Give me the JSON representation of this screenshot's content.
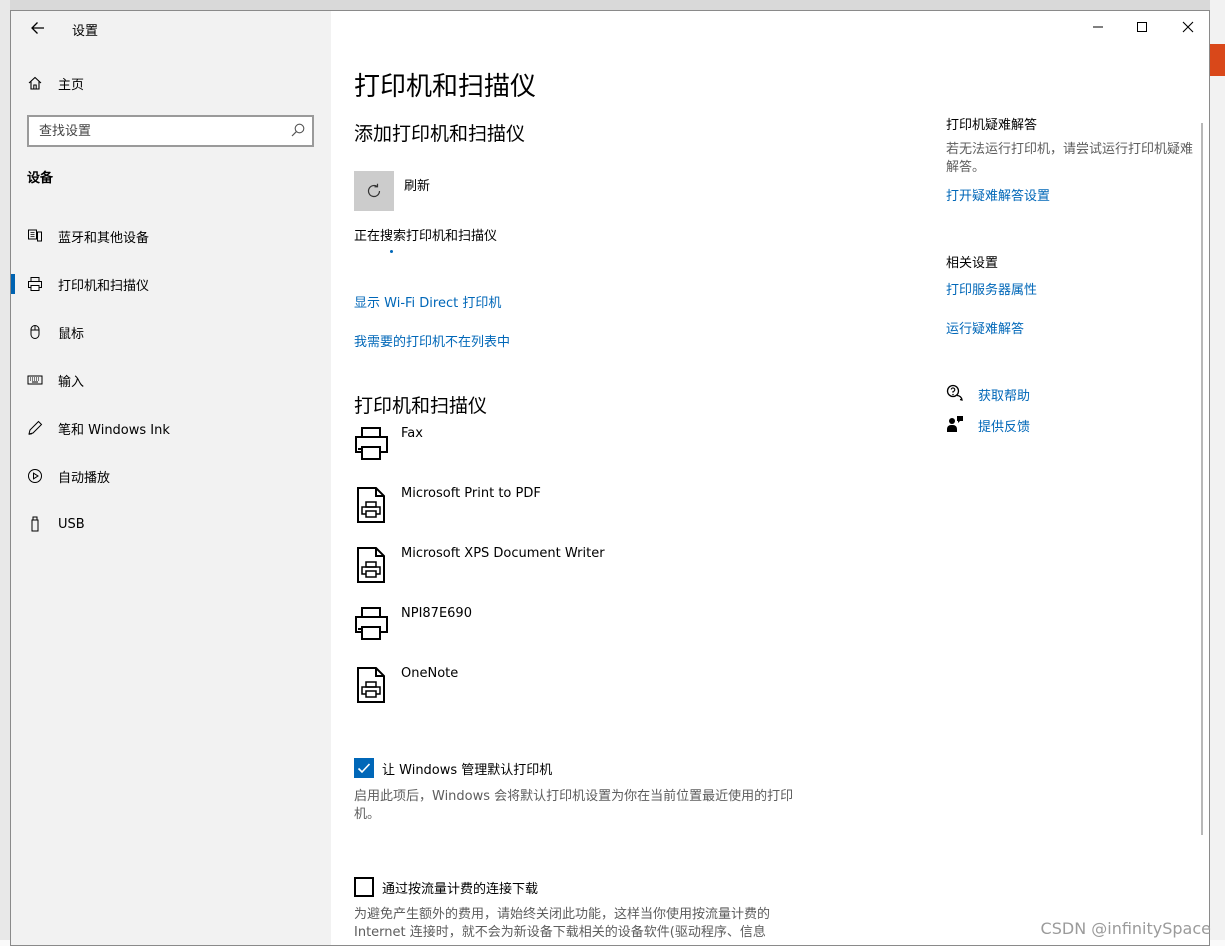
{
  "window": {
    "title": "设置",
    "back_icon": "back-arrow-icon",
    "minimize_icon": "minimize-icon",
    "maximize_icon": "maximize-icon",
    "close_icon": "close-icon"
  },
  "sidebar": {
    "home": {
      "label": "主页",
      "icon": "home-icon"
    },
    "search": {
      "placeholder": "查找设置",
      "icon": "search-icon"
    },
    "section_title": "设备",
    "items": [
      {
        "label": "蓝牙和其他设备",
        "icon": "bluetooth-devices-icon",
        "selected": false
      },
      {
        "label": "打印机和扫描仪",
        "icon": "printer-icon",
        "selected": true
      },
      {
        "label": "鼠标",
        "icon": "mouse-icon",
        "selected": false
      },
      {
        "label": "输入",
        "icon": "keyboard-icon",
        "selected": false
      },
      {
        "label": "笔和 Windows Ink",
        "icon": "pen-icon",
        "selected": false
      },
      {
        "label": "自动播放",
        "icon": "autoplay-icon",
        "selected": false
      },
      {
        "label": "USB",
        "icon": "usb-icon",
        "selected": false
      }
    ],
    "accent_color": "#0063b1"
  },
  "main": {
    "page_title": "打印机和扫描仪",
    "add_section": {
      "title": "添加打印机和扫描仪",
      "refresh_label": "刷新",
      "refresh_icon": "refresh-icon",
      "searching_text": "正在搜索打印机和扫描仪",
      "wifi_direct_link": "显示 Wi-Fi Direct 打印机",
      "not_listed_link": "我需要的打印机不在列表中"
    },
    "printers_section": {
      "title": "打印机和扫描仪",
      "printers": [
        {
          "name": "Fax",
          "icon": "printer-icon"
        },
        {
          "name": "Microsoft Print to PDF",
          "icon": "document-printer-icon"
        },
        {
          "name": "Microsoft XPS Document Writer",
          "icon": "document-printer-icon"
        },
        {
          "name": "NPI87E690",
          "icon": "printer-icon"
        },
        {
          "name": "OneNote",
          "icon": "document-printer-icon"
        }
      ]
    },
    "default_printer": {
      "label": "让 Windows 管理默认打印机",
      "checked": true,
      "description": "启用此项后，Windows 会将默认打印机设置为你在当前位置最近使用的打印机。"
    },
    "metered": {
      "label": "通过按流量计费的连接下载",
      "checked": false,
      "description": "为避免产生额外的费用，请始终关闭此功能，这样当你使用按流量计费的Internet 连接时，就不会为新设备下载相关的设备软件(驱动程序、信息"
    },
    "link_color": "#0067b8"
  },
  "right_panel": {
    "troubleshoot": {
      "title": "打印机疑难解答",
      "text": "若无法运行打印机，请尝试运行打印机疑难解答。",
      "link": "打开疑难解答设置"
    },
    "related": {
      "title": "相关设置",
      "links": [
        "打印服务器属性",
        "运行疑难解答"
      ]
    },
    "help": {
      "label": "获取帮助",
      "icon": "help-chat-icon"
    },
    "feedback": {
      "label": "提供反馈",
      "icon": "feedback-icon"
    }
  },
  "watermark": "CSDN @infinitySpace"
}
